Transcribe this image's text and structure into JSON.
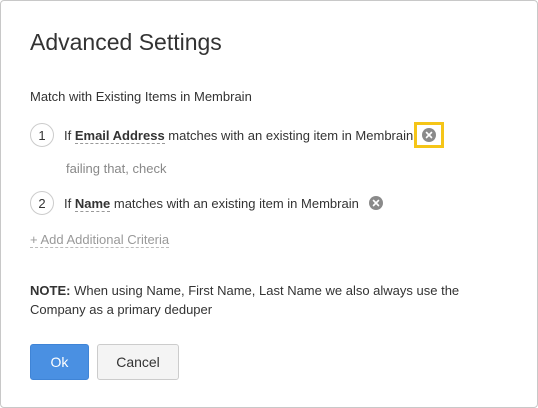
{
  "dialog": {
    "title": "Advanced Settings",
    "section_label": "Match with Existing Items in Membrain",
    "criteria": [
      {
        "number": "1",
        "prefix": "If ",
        "field": "Email Address",
        "suffix": " matches with an existing item in Membrain",
        "remove_icon": "close-circle-icon",
        "highlighted": true
      },
      {
        "number": "2",
        "prefix": "If ",
        "field": "Name",
        "suffix": " matches with an existing item in Membrain",
        "remove_icon": "close-circle-icon",
        "highlighted": false
      }
    ],
    "failing_text": "failing that, check",
    "add_criteria_label": "+ Add Additional Criteria",
    "note": {
      "label": "NOTE:",
      "text": " When using Name, First Name, Last Name we also always use the Company as a primary deduper"
    },
    "buttons": {
      "ok_label": "Ok",
      "cancel_label": "Cancel"
    },
    "colors": {
      "primary": "#4a90e2",
      "highlight": "#f5c518",
      "muted": "#888888"
    }
  }
}
